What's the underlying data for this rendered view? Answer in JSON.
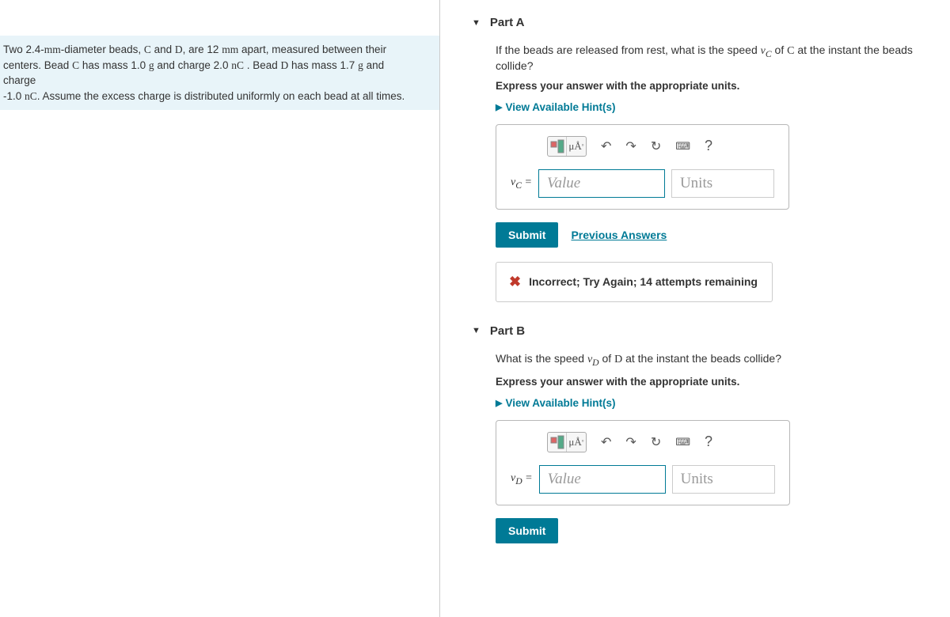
{
  "problem": {
    "line1_pre": "Two 2.4-",
    "line1_mm": "mm",
    "line1_mid": "-diameter beads, ",
    "line1_c": "C",
    "line1_and": " and ",
    "line1_d": "D",
    "line1_post": ", are 12 ",
    "line1_mm2": "mm",
    "line1_end": " apart, measured between their",
    "line2_pre": "centers.  Bead ",
    "line2_c": "C",
    "line2_mid": " has mass 1.0 ",
    "line2_g": "g",
    "line2_mid2": " and charge 2.0 ",
    "line2_nc": "nC",
    "line2_mid3": " .  Bead ",
    "line2_d": "D",
    "line2_mid4": " has mass 1.7 ",
    "line2_g2": "g",
    "line2_end": " and",
    "line3": "charge",
    "line4_pre": "-1.0 ",
    "line4_nc": "nC",
    "line4_end": ".  Assume the excess charge is distributed uniformly on each bead at all times."
  },
  "partA": {
    "title": "Part A",
    "question_pre": "If the beads are released from rest, what is the speed ",
    "question_var": "v",
    "question_sub": "C",
    "question_mid": " of ",
    "question_c": "C",
    "question_end": " at the instant the beads collide?",
    "instruction": "Express your answer with the appropriate units.",
    "hints": "View Available Hint(s)",
    "var_label_v": "v",
    "var_label_sub": "C",
    "equals": " = ",
    "value_placeholder": "Value",
    "units_placeholder": "Units",
    "submit": "Submit",
    "previous": "Previous Answers",
    "feedback": "Incorrect; Try Again; 14 attempts remaining"
  },
  "partB": {
    "title": "Part B",
    "question_pre": "What is the speed ",
    "question_var": "v",
    "question_sub": "D",
    "question_mid": " of ",
    "question_d": "D",
    "question_end": " at the instant the beads collide?",
    "instruction": "Express your answer with the appropriate units.",
    "hints": "View Available Hint(s)",
    "var_label_v": "v",
    "var_label_sub": "D",
    "equals": " = ",
    "value_placeholder": "Value",
    "units_placeholder": "Units",
    "submit": "Submit"
  },
  "toolbar": {
    "help": "?"
  }
}
